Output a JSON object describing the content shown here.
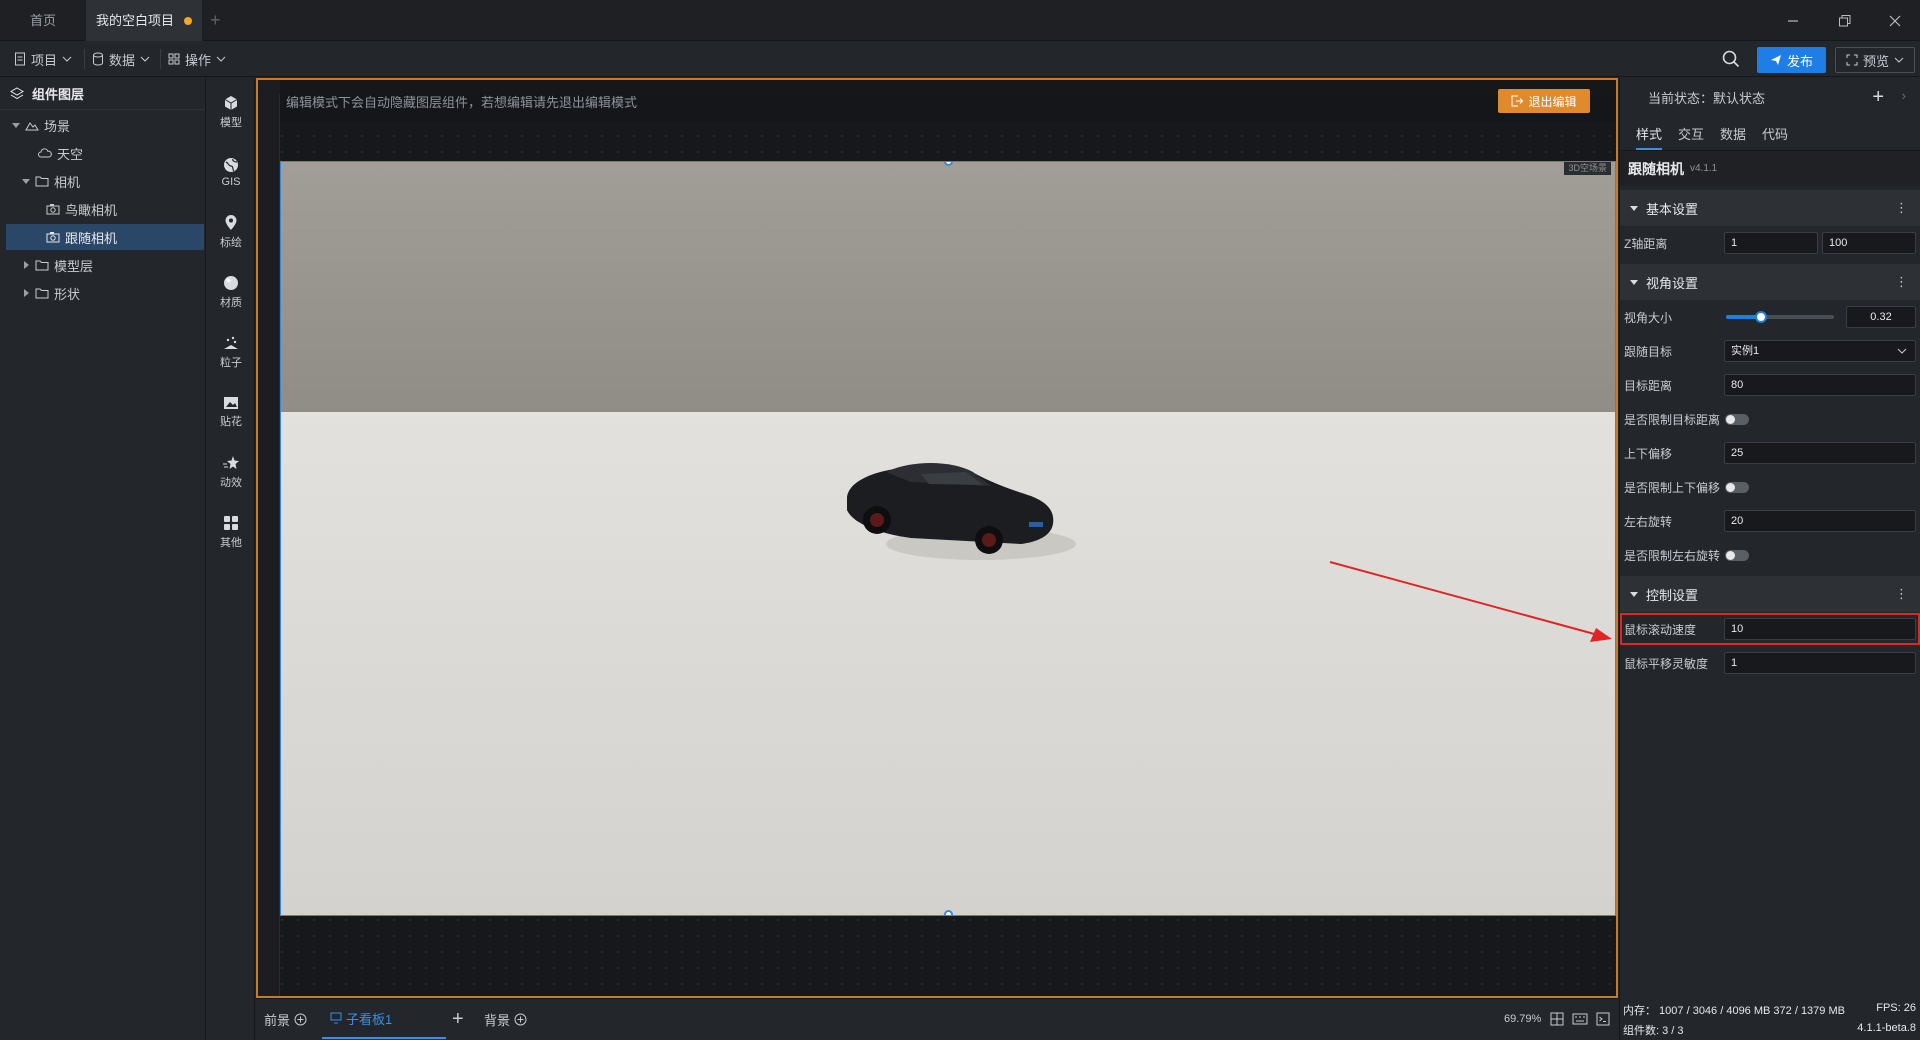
{
  "tabs": {
    "home": "首页",
    "project": "我的空白项目"
  },
  "toolbar": {
    "project_menu": "项目",
    "data_menu": "数据",
    "ops_menu": "操作",
    "publish_label": "发布",
    "preview_label": "预览"
  },
  "layers": {
    "title": "组件图层",
    "items": [
      "场景",
      "天空",
      "相机",
      "鸟瞰相机",
      "跟随相机",
      "模型层",
      "形状"
    ]
  },
  "iconbar": {
    "items": [
      "模型",
      "GIS",
      "标绘",
      "材质",
      "粒子",
      "贴花",
      "动效",
      "其他"
    ]
  },
  "canvas": {
    "hint": "编辑模式下会自动隐藏图层组件，若想编辑请先退出编辑模式",
    "exit_label": "退出编辑",
    "badge": "3D空场景"
  },
  "bottom": {
    "front_label": "前景",
    "board_label": "子看板1",
    "back_label": "背景",
    "zoom": "69.79%"
  },
  "props": {
    "state_label": "当前状态：默认状态",
    "tabs": [
      "样式",
      "交互",
      "数据",
      "代码"
    ],
    "component_name": "跟随相机",
    "component_version": "v4.1.1",
    "sections": {
      "basic": "基本设置",
      "view": "视角设置",
      "control": "控制设置"
    },
    "z_axis": {
      "label": "Z轴距离",
      "min": "1",
      "max": "100"
    },
    "fov": {
      "label": "视角大小",
      "value": "0.32",
      "fraction": 0.32
    },
    "follow_target": {
      "label": "跟随目标",
      "value": "实例1"
    },
    "target_distance": {
      "label": "目标距离",
      "value": "80"
    },
    "limit_distance": {
      "label": "是否限制目标距离"
    },
    "vertical_offset": {
      "label": "上下偏移",
      "value": "25"
    },
    "limit_vertical": {
      "label": "是否限制上下偏移"
    },
    "horizontal_rotate": {
      "label": "左右旋转",
      "value": "20"
    },
    "limit_horizontal": {
      "label": "是否限制左右旋转"
    },
    "scroll_speed": {
      "label": "鼠标滚动速度",
      "value": "10"
    },
    "pan_sensitivity": {
      "label": "鼠标平移灵敏度",
      "value": "1"
    }
  },
  "status": {
    "memory": "内存： 1007 / 3046 / 4096 MB  372 / 1379 MB",
    "fps": "FPS:  26",
    "components": "组件数: 3 / 3",
    "version": "4.1.1-beta.8"
  },
  "colors": {
    "accent": "#1e7ee6",
    "highlight": "#e02525",
    "edit_border": "#c77a2a"
  }
}
